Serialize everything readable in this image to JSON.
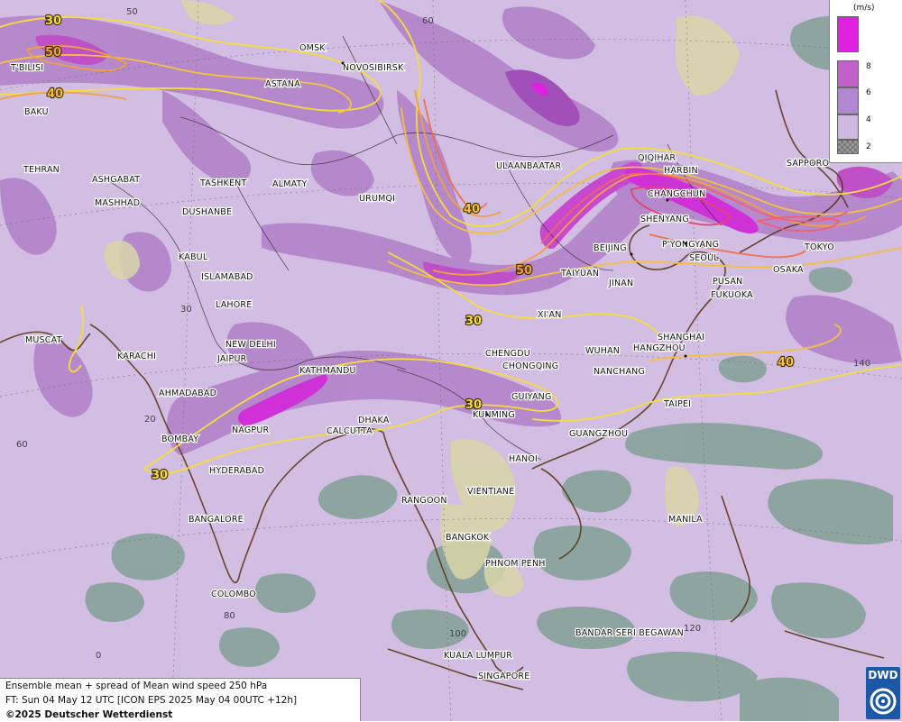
{
  "legend": {
    "unit": "(m/s)",
    "levels": [
      {
        "label": "",
        "color": "#e020e0"
      },
      {
        "label": "8",
        "color": "#c060c8"
      },
      {
        "label": "6",
        "color": "#b088d0"
      },
      {
        "label": "4",
        "color": "#cdb8e0"
      },
      {
        "label": "2",
        "color": "#9a9a9a"
      }
    ]
  },
  "caption": {
    "line1": "Ensemble mean + spread of Mean wind speed 250 hPa",
    "line2": "FT: Sun 04 May 12 UTC [ICON EPS 2025 May 04 00UTC +12h]",
    "line3": "©2025 Deutscher Wetterdienst"
  },
  "logo": {
    "text": "DWD"
  },
  "grid_labels": [
    "50",
    "60",
    "30",
    "20",
    "60",
    "80",
    "0",
    "100",
    "120",
    "140"
  ],
  "contour_labels": [
    {
      "text": "30",
      "color": "#f5dc3c"
    },
    {
      "text": "50",
      "color": "#f0a040"
    },
    {
      "text": "40",
      "color": "#f5c040"
    },
    {
      "text": "40",
      "color": "#f5c040"
    },
    {
      "text": "50",
      "color": "#f0a040"
    },
    {
      "text": "30",
      "color": "#f5dc3c"
    },
    {
      "text": "30",
      "color": "#f5dc3c"
    },
    {
      "text": "30",
      "color": "#f5dc3c"
    },
    {
      "text": "40",
      "color": "#f5c040"
    }
  ],
  "cities": [
    "OMSK",
    "NOVOSIBIRSK",
    "ASTANA",
    "T'BILISI",
    "BAKU",
    "TEHRAN",
    "ASHGABAT",
    "MASHHAD",
    "TASHKENT",
    "DUSHANBE",
    "ALMATY",
    "URUMQI",
    "ULAANBAATAR",
    "QIQIHAR",
    "HARBIN",
    "SAPPORO",
    "CHANGCHUN",
    "SHENYANG",
    "P'YONGYANG",
    "SEOUL",
    "BEIJING",
    "TOKYO",
    "OSAKA",
    "PUSAN",
    "FUKUOKA",
    "TAIYUAN",
    "JINAN",
    "KABUL",
    "ISLAMABAD",
    "LAHORE",
    "XI'AN",
    "SHANGHAI",
    "HANGZHOU",
    "NEW DELHI",
    "JAIPUR",
    "MUSCAT",
    "KARACHI",
    "KATHMANDU",
    "CHENGDU",
    "CHONGQING",
    "WUHAN",
    "NANCHANG",
    "AHMADABAD",
    "TAIPEI",
    "GUIYANG",
    "NAGPUR",
    "DHAKA",
    "CALCUTTA",
    "KUNMING",
    "BOMBAY",
    "GUANGZHOU",
    "HYDERABAD",
    "HANOI",
    "RANGOON",
    "VIENTIANE",
    "BANGALORE",
    "MANILA",
    "BANGKOK",
    "PHNOM PENH",
    "COLOMBO",
    "BANDAR SERI BEGAWAN",
    "KUALA LUMPUR",
    "SINGAPORE"
  ]
}
